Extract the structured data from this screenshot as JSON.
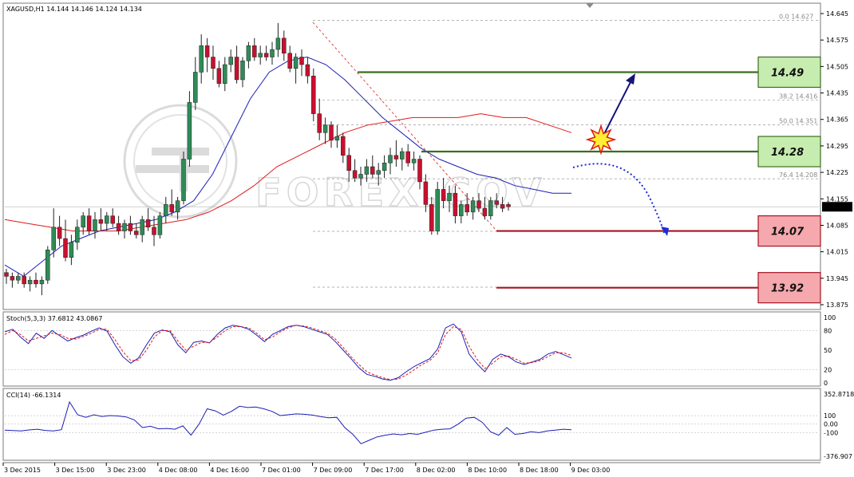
{
  "chart_data": [
    {
      "type": "candlestick",
      "symbol_header": "XAGUSD,H1  14.144 14.146 14.124 14.134",
      "last_price_label": "14.134",
      "ylim": [
        13.86,
        14.65
      ],
      "y_ticks": [
        "14.645",
        "14.575",
        "14.505",
        "14.435",
        "14.365",
        "14.295",
        "14.225",
        "14.155",
        "14.085",
        "14.015",
        "13.945",
        "13.875"
      ],
      "x_ticks": [
        "3 Dec 2015",
        "3 Dec 15:00",
        "3 Dec 23:00",
        "4 Dec 08:00",
        "4 Dec 16:00",
        "7 Dec 01:00",
        "7 Dec 09:00",
        "7 Dec 17:00",
        "8 Dec 02:00",
        "8 Dec 10:00",
        "8 Dec 18:00",
        "9 Dec 03:00"
      ],
      "colors": {
        "bull": "#2e8b57",
        "bear": "#c8102e",
        "ma_fast": "#1c1fb5",
        "ma_slow": "#e0191b",
        "resistance": "#3a6e1f",
        "support": "#a31523",
        "target_arrow": "#14147a"
      },
      "ohlc": [
        [
          13.96,
          13.97,
          13.93,
          13.95
        ],
        [
          13.95,
          13.96,
          13.92,
          13.94
        ],
        [
          13.94,
          13.96,
          13.93,
          13.95
        ],
        [
          13.95,
          13.96,
          13.92,
          13.93
        ],
        [
          13.93,
          13.95,
          13.91,
          13.94
        ],
        [
          13.94,
          13.96,
          13.92,
          13.93
        ],
        [
          13.93,
          13.95,
          13.9,
          13.94
        ],
        [
          13.94,
          14.03,
          13.93,
          14.02
        ],
        [
          14.02,
          14.13,
          14.0,
          14.08
        ],
        [
          14.08,
          14.11,
          14.03,
          14.05
        ],
        [
          14.05,
          14.1,
          13.99,
          14.0
        ],
        [
          14.0,
          14.06,
          13.98,
          14.04
        ],
        [
          14.04,
          14.1,
          14.02,
          14.08
        ],
        [
          14.08,
          14.12,
          14.06,
          14.11
        ],
        [
          14.11,
          14.13,
          14.06,
          14.07
        ],
        [
          14.07,
          14.12,
          14.05,
          14.1
        ],
        [
          14.1,
          14.13,
          14.07,
          14.09
        ],
        [
          14.09,
          14.12,
          14.07,
          14.11
        ],
        [
          14.11,
          14.13,
          14.08,
          14.09
        ],
        [
          14.09,
          14.11,
          14.06,
          14.07
        ],
        [
          14.07,
          14.1,
          14.05,
          14.09
        ],
        [
          14.09,
          14.11,
          14.06,
          14.07
        ],
        [
          14.07,
          14.09,
          14.05,
          14.06
        ],
        [
          14.06,
          14.11,
          14.04,
          14.1
        ],
        [
          14.1,
          14.13,
          14.07,
          14.08
        ],
        [
          14.08,
          14.11,
          14.03,
          14.06
        ],
        [
          14.06,
          14.12,
          14.05,
          14.11
        ],
        [
          14.11,
          14.16,
          14.09,
          14.14
        ],
        [
          14.14,
          14.18,
          14.11,
          14.12
        ],
        [
          14.12,
          14.16,
          14.1,
          14.15
        ],
        [
          14.15,
          14.28,
          14.14,
          14.26
        ],
        [
          14.26,
          14.44,
          14.24,
          14.41
        ],
        [
          14.41,
          14.53,
          14.39,
          14.49
        ],
        [
          14.49,
          14.59,
          14.46,
          14.56
        ],
        [
          14.56,
          14.58,
          14.49,
          14.53
        ],
        [
          14.53,
          14.56,
          14.47,
          14.5
        ],
        [
          14.5,
          14.52,
          14.45,
          14.46
        ],
        [
          14.46,
          14.53,
          14.44,
          14.51
        ],
        [
          14.51,
          14.55,
          14.49,
          14.53
        ],
        [
          14.53,
          14.56,
          14.46,
          14.47
        ],
        [
          14.47,
          14.53,
          14.45,
          14.52
        ],
        [
          14.52,
          14.57,
          14.5,
          14.56
        ],
        [
          14.56,
          14.58,
          14.52,
          14.53
        ],
        [
          14.53,
          14.56,
          14.51,
          14.54
        ],
        [
          14.54,
          14.56,
          14.52,
          14.53
        ],
        [
          14.53,
          14.57,
          14.51,
          14.55
        ],
        [
          14.55,
          14.62,
          14.53,
          14.58
        ],
        [
          14.58,
          14.6,
          14.52,
          14.54
        ],
        [
          14.54,
          14.56,
          14.49,
          14.5
        ],
        [
          14.5,
          14.54,
          14.46,
          14.53
        ],
        [
          14.53,
          14.55,
          14.48,
          14.51
        ],
        [
          14.51,
          14.53,
          14.46,
          14.48
        ],
        [
          14.48,
          14.5,
          14.36,
          14.38
        ],
        [
          14.38,
          14.42,
          14.31,
          14.33
        ],
        [
          14.33,
          14.37,
          14.3,
          14.35
        ],
        [
          14.35,
          14.36,
          14.29,
          14.31
        ],
        [
          14.31,
          14.35,
          14.29,
          14.32
        ],
        [
          14.32,
          14.33,
          14.25,
          14.27
        ],
        [
          14.27,
          14.29,
          14.2,
          14.23
        ],
        [
          14.23,
          14.26,
          14.2,
          14.21
        ],
        [
          14.21,
          14.24,
          14.19,
          14.22
        ],
        [
          14.22,
          14.26,
          14.2,
          14.24
        ],
        [
          14.24,
          14.27,
          14.21,
          14.22
        ],
        [
          14.22,
          14.25,
          14.19,
          14.23
        ],
        [
          14.23,
          14.27,
          14.21,
          14.25
        ],
        [
          14.25,
          14.29,
          14.22,
          14.27
        ],
        [
          14.27,
          14.31,
          14.24,
          14.26
        ],
        [
          14.26,
          14.29,
          14.23,
          14.28
        ],
        [
          14.28,
          14.3,
          14.24,
          14.25
        ],
        [
          14.25,
          14.28,
          14.23,
          14.26
        ],
        [
          14.26,
          14.27,
          14.18,
          14.2
        ],
        [
          14.2,
          14.22,
          14.12,
          14.14
        ],
        [
          14.14,
          14.16,
          14.06,
          14.07
        ],
        [
          14.07,
          14.2,
          14.06,
          14.18
        ],
        [
          14.18,
          14.21,
          14.13,
          14.15
        ],
        [
          14.15,
          14.19,
          14.12,
          14.17
        ],
        [
          14.17,
          14.19,
          14.09,
          14.11
        ],
        [
          14.11,
          14.15,
          14.09,
          14.14
        ],
        [
          14.14,
          14.17,
          14.11,
          14.12
        ],
        [
          14.12,
          14.16,
          14.1,
          14.15
        ],
        [
          14.15,
          14.17,
          14.12,
          14.13
        ],
        [
          14.13,
          14.16,
          14.1,
          14.11
        ],
        [
          14.11,
          14.16,
          14.1,
          14.15
        ],
        [
          14.15,
          14.17,
          14.13,
          14.14
        ],
        [
          14.14,
          14.16,
          14.12,
          14.13
        ],
        [
          14.14,
          14.146,
          14.124,
          14.134
        ]
      ],
      "moving_average_fast": [
        13.98,
        13.95,
        13.99,
        14.03,
        14.05,
        14.07,
        14.08,
        14.09,
        14.1,
        14.12,
        14.15,
        14.22,
        14.32,
        14.42,
        14.49,
        14.52,
        14.53,
        14.51,
        14.47,
        14.42,
        14.37,
        14.33,
        14.29,
        14.26,
        14.24,
        14.22,
        14.21,
        14.19,
        14.18,
        14.17,
        14.17
      ],
      "moving_average_slow": [
        14.1,
        14.09,
        14.08,
        14.07,
        14.07,
        14.07,
        14.08,
        14.09,
        14.1,
        14.12,
        14.15,
        14.19,
        14.24,
        14.27,
        14.3,
        14.33,
        14.35,
        14.36,
        14.37,
        14.37,
        14.37,
        14.38,
        14.37,
        14.37,
        14.35,
        14.33
      ],
      "fibonacci_levels": [
        {
          "label": "0.0",
          "value": 14.627
        },
        {
          "label": "38.2",
          "value": 14.416
        },
        {
          "label": "50.0",
          "value": 14.351
        },
        {
          "label": "76.4",
          "value": 14.208
        }
      ],
      "key_levels": [
        {
          "name": "resistance",
          "value": "14.49"
        },
        {
          "name": "resistance",
          "value": "14.28"
        },
        {
          "name": "support",
          "value": "14.07"
        },
        {
          "name": "support",
          "value": "13.92"
        }
      ]
    },
    {
      "type": "line",
      "header": "Stoch(5,3,3) 37.6812 43.0867",
      "ylim": [
        0,
        100
      ],
      "y_ticks": [
        "100",
        "80",
        "50",
        "20",
        "0"
      ],
      "series": [
        {
          "values": [
            78,
            82,
            70,
            60,
            76,
            68,
            80,
            72,
            64,
            69,
            73,
            79,
            84,
            79,
            58,
            40,
            30,
            38,
            58,
            76,
            81,
            78,
            58,
            46,
            62,
            64,
            61,
            74,
            84,
            88,
            86,
            82,
            73,
            63,
            74,
            80,
            86,
            88,
            86,
            82,
            78,
            74,
            63,
            50,
            37,
            23,
            13,
            10,
            6,
            4,
            8,
            17,
            25,
            31,
            37,
            52,
            84,
            90,
            78,
            44,
            29,
            17,
            36,
            44,
            40,
            32,
            28,
            32,
            36,
            44,
            48,
            43,
            38
          ]
        },
        {
          "values": [
            74,
            80,
            74,
            64,
            68,
            72,
            76,
            74,
            68,
            67,
            71,
            76,
            82,
            82,
            66,
            48,
            34,
            35,
            50,
            70,
            80,
            80,
            64,
            50,
            56,
            62,
            62,
            70,
            80,
            86,
            86,
            84,
            76,
            66,
            70,
            78,
            84,
            88,
            87,
            84,
            80,
            76,
            67,
            54,
            40,
            28,
            17,
            12,
            8,
            5,
            6,
            12,
            20,
            28,
            34,
            46,
            74,
            86,
            82,
            56,
            36,
            22,
            30,
            40,
            41,
            36,
            30,
            31,
            34,
            40,
            46,
            46,
            42
          ]
        }
      ]
    },
    {
      "type": "line",
      "header": "CCI(14) -66.1314",
      "ylim": [
        -376.907,
        352.8718
      ],
      "y_ticks": [
        "352.8718",
        "100",
        "0.00",
        "-100",
        "-376.907"
      ],
      "series": [
        {
          "values": [
            -70,
            -75,
            -80,
            -68,
            -60,
            -74,
            -80,
            -65,
            260,
            110,
            80,
            110,
            90,
            100,
            96,
            84,
            50,
            -40,
            -25,
            -55,
            -50,
            -60,
            -20,
            -130,
            0,
            180,
            155,
            105,
            150,
            210,
            195,
            200,
            180,
            150,
            100,
            110,
            120,
            115,
            106,
            88,
            74,
            80,
            -40,
            -120,
            -230,
            -190,
            -150,
            -130,
            -115,
            -125,
            -110,
            -120,
            -95,
            -70,
            -60,
            -55,
            0,
            70,
            80,
            20,
            -90,
            -130,
            -40,
            -120,
            -110,
            -90,
            -100,
            -80,
            -70,
            -60,
            -66
          ]
        }
      ]
    }
  ]
}
